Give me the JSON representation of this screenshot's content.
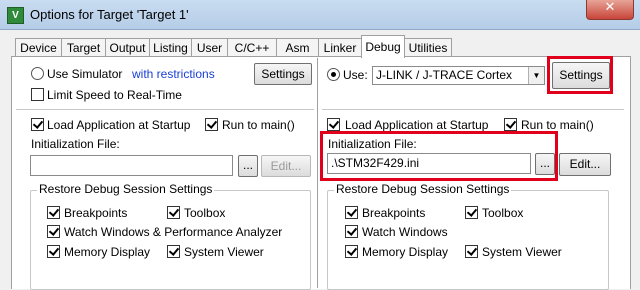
{
  "window": {
    "title": "Options for Target 'Target 1'",
    "app_icon_letter": "V",
    "close_glyph": "✕"
  },
  "tabs": [
    {
      "label": "Device"
    },
    {
      "label": "Target"
    },
    {
      "label": "Output"
    },
    {
      "label": "Listing"
    },
    {
      "label": "User"
    },
    {
      "label": "C/C++"
    },
    {
      "label": "Asm"
    },
    {
      "label": "Linker"
    },
    {
      "label": "Debug",
      "active": true
    },
    {
      "label": "Utilities"
    }
  ],
  "left": {
    "use_simulator_label": "Use Simulator",
    "restrictions_link": "with restrictions",
    "settings_label": "Settings",
    "limit_speed_label": "Limit Speed to Real-Time",
    "load_app_label": "Load Application at Startup",
    "run_to_main_label": "Run to main()",
    "init_file_label": "Initialization File:",
    "init_file_value": "",
    "browse_label": "...",
    "edit_label": "Edit...",
    "restore_group_title": "Restore Debug Session Settings",
    "breakpoints_label": "Breakpoints",
    "toolbox_label": "Toolbox",
    "watch_label": "Watch Windows & Performance Analyzer",
    "memory_label": "Memory Display",
    "system_viewer_label": "System Viewer"
  },
  "right": {
    "use_label": "Use:",
    "debugger_value": "J-LINK / J-TRACE Cortex",
    "settings_label": "Settings",
    "load_app_label": "Load Application at Startup",
    "run_to_main_label": "Run to main()",
    "init_file_label": "Initialization File:",
    "init_file_value": ".\\STM32F429.ini",
    "browse_label": "...",
    "edit_label": "Edit...",
    "restore_group_title": "Restore Debug Session Settings",
    "breakpoints_label": "Breakpoints",
    "toolbox_label": "Toolbox",
    "watch_label": "Watch Windows",
    "memory_label": "Memory Display",
    "system_viewer_label": "System Viewer"
  },
  "colors": {
    "highlight": "#e0001b",
    "link": "#1a3fd6"
  }
}
